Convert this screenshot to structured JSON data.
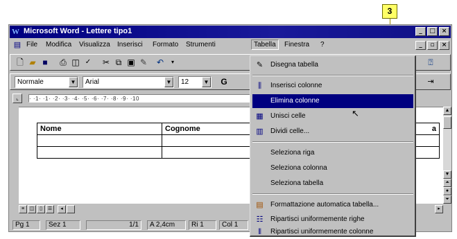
{
  "callout": {
    "label": "3"
  },
  "window": {
    "title": "Microsoft Word - Lettere tipo1",
    "controls": [
      "_",
      "□",
      "×"
    ],
    "doc_controls": [
      "_",
      "▫",
      "×"
    ]
  },
  "menubar": {
    "items": [
      "File",
      "Modifica",
      "Visualizza",
      "Inserisci",
      "Formato",
      "Strumenti",
      "Tabella",
      "Finestra",
      "?"
    ]
  },
  "toolbar": {
    "buttons": [
      "new-icon",
      "open-icon",
      "save-icon",
      "print-icon",
      "print-preview-icon",
      "spelling-icon",
      "cut-icon",
      "copy-icon",
      "paste-icon",
      "format-painter-icon",
      "undo-icon"
    ],
    "right_icon": "help-icon"
  },
  "formatting": {
    "style": "Normale",
    "font": "Arial",
    "size": "12",
    "bold": "G"
  },
  "ruler": {
    "text": "· ·1· ·1· ·2· ·3· ·4· ·5· ·6· ·7· ·8· ·9· ·10"
  },
  "document": {
    "table": {
      "headers": [
        "Nome",
        "Cognome",
        "a"
      ],
      "rows": [
        [
          "",
          "",
          ""
        ],
        [
          "",
          "",
          ""
        ]
      ]
    }
  },
  "statusbar": {
    "page": "Pg 1",
    "section": "Sez 1",
    "pages": "1/1",
    "at": "A 2,4cm",
    "line": "Ri 1",
    "col": "Col 1"
  },
  "dropdown": {
    "items": [
      {
        "label": "Disegna tabella",
        "icon": "pencil-icon"
      },
      {
        "label": "Inserisci colonne",
        "icon": "insert-columns-icon"
      },
      {
        "label": "Elimina colonne",
        "icon": "",
        "selected": true
      },
      {
        "label": "Unisci celle",
        "icon": "merge-cells-icon"
      },
      {
        "label": "Dividi celle...",
        "icon": "split-cells-icon"
      },
      {
        "label": "Seleziona riga",
        "icon": ""
      },
      {
        "label": "Seleziona colonna",
        "icon": ""
      },
      {
        "label": "Seleziona tabella",
        "icon": ""
      },
      {
        "label": "Formattazione automatica tabella...",
        "icon": "autoformat-icon"
      },
      {
        "label": "Ripartisci uniformemente righe",
        "icon": "distribute-rows-icon"
      },
      {
        "label": "Ripartisci uniformemente colonne",
        "icon": "distribute-columns-icon"
      }
    ]
  }
}
